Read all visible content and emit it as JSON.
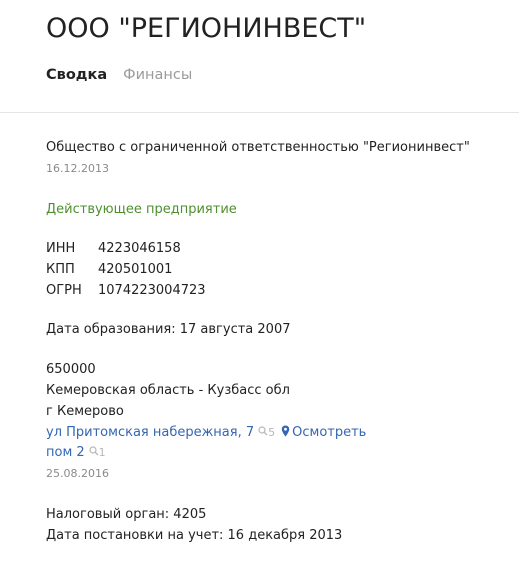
{
  "header": {
    "company_name": "ООО \"РЕГИОНИНВЕСТ\"",
    "tabs": [
      {
        "label": "Сводка",
        "active": true
      },
      {
        "label": "Финансы",
        "active": false
      }
    ]
  },
  "summary": {
    "full_name": "Общество с ограниченной ответственностью \"Регионинвест\"",
    "full_name_date": "16.12.2013",
    "status": "Действующее предприятие",
    "codes": [
      {
        "label": "ИНН",
        "value": "4223046158"
      },
      {
        "label": "КПП",
        "value": "420501001"
      },
      {
        "label": "ОГРН",
        "value": "1074223004723"
      }
    ],
    "registration_date": "Дата образования: 17 августа 2007",
    "address": {
      "postal_code": "650000",
      "region": "Кемеровская область - Кузбасс обл",
      "city": "г Кемерово",
      "street": "ул Притомская набережная, 7",
      "street_count": "5",
      "view_label": "Осмотреть",
      "room": "пом 2",
      "room_count": "1",
      "date": "25.08.2016"
    },
    "tax_authority": "Налоговый орган: 4205",
    "tax_registration": "Дата постановки на учет: 16 декабря 2013"
  },
  "colors": {
    "status_green": "#4f8f2f",
    "link_blue": "#3466b3",
    "muted_gray": "#8a8a8a"
  },
  "icons": {
    "search": "magnifier-icon",
    "location": "map-pin-icon"
  }
}
